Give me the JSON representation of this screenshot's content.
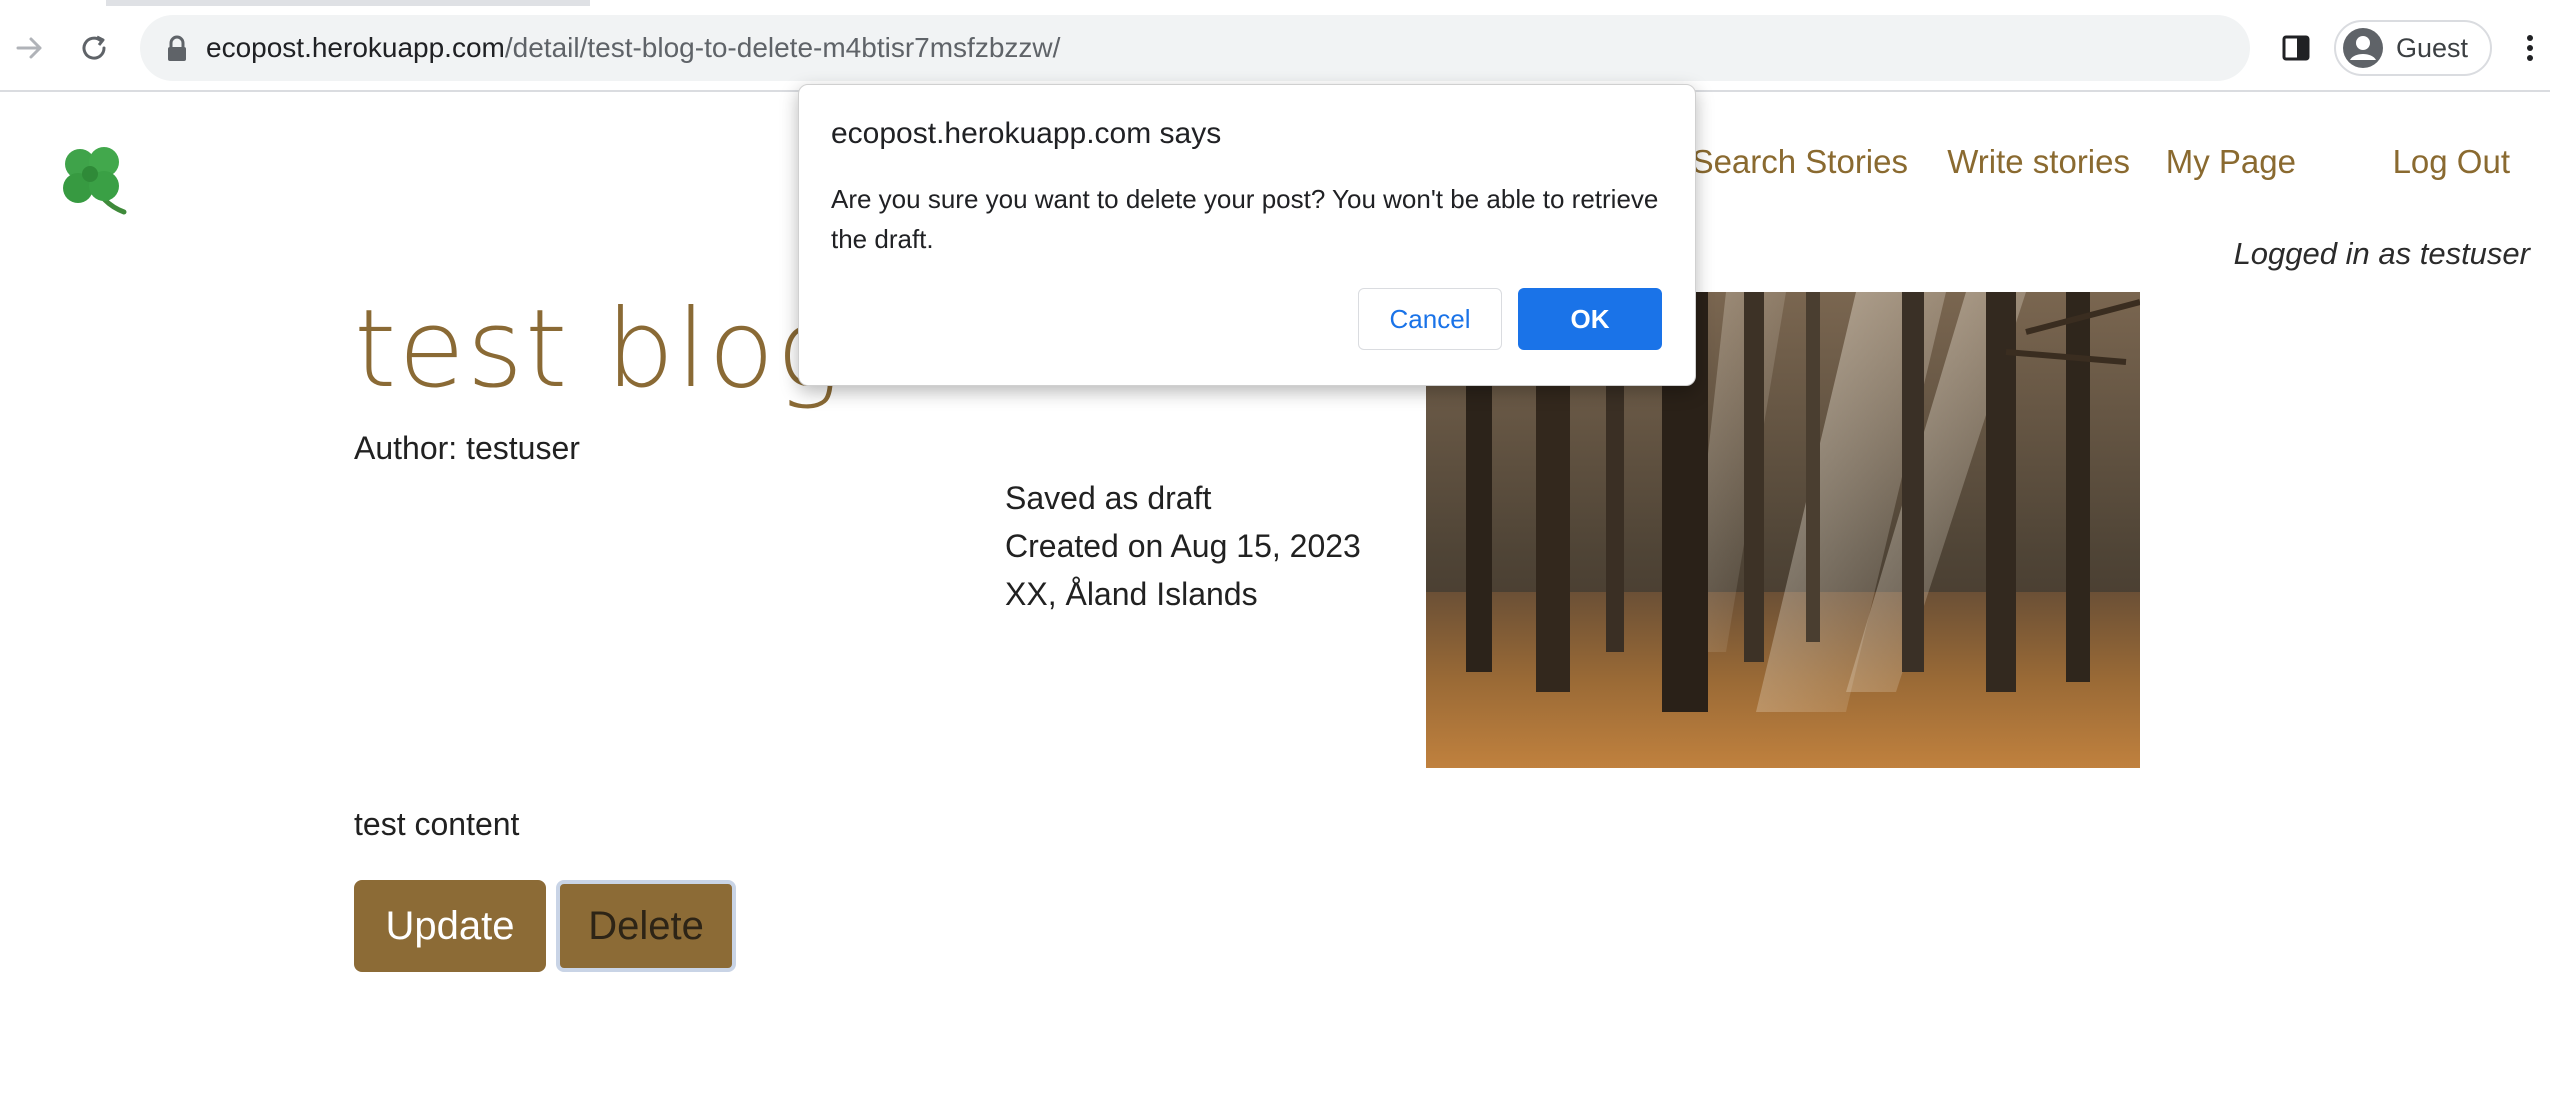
{
  "browser": {
    "url_host": "ecopost.herokuapp.com",
    "url_path": "/detail/test-blog-to-delete-m4btisr7msfzbzzw/",
    "profile_name": "Guest",
    "icons": [
      "forward-arrow-icon",
      "reload-icon",
      "lock-icon",
      "side-panel-icon",
      "profile-avatar-icon",
      "kebab-menu-icon"
    ]
  },
  "site": {
    "logo_icon": "four-leaf-clover-icon",
    "nav": {
      "search": "Search Stories",
      "write": "Write stories",
      "mypage": "My Page",
      "logout": "Log Out"
    },
    "logged_in": "Logged in as testuser",
    "accent_color": "#8a6a30"
  },
  "post": {
    "title": "test blog",
    "author": "Author: testuser",
    "status": "Saved as draft",
    "created": "Created on Aug 15, 2023",
    "location": "XX, Åland Islands",
    "image": "forest-sunlight-photo",
    "content": "test content",
    "update_label": "Update",
    "delete_label": "Delete"
  },
  "dialog": {
    "title": "ecopost.herokuapp.com says",
    "message": "Are you sure you want to delete your post?  You won't be able to retrieve the draft.",
    "cancel_label": "Cancel",
    "ok_label": "OK",
    "ok_color": "#1a73e8"
  }
}
